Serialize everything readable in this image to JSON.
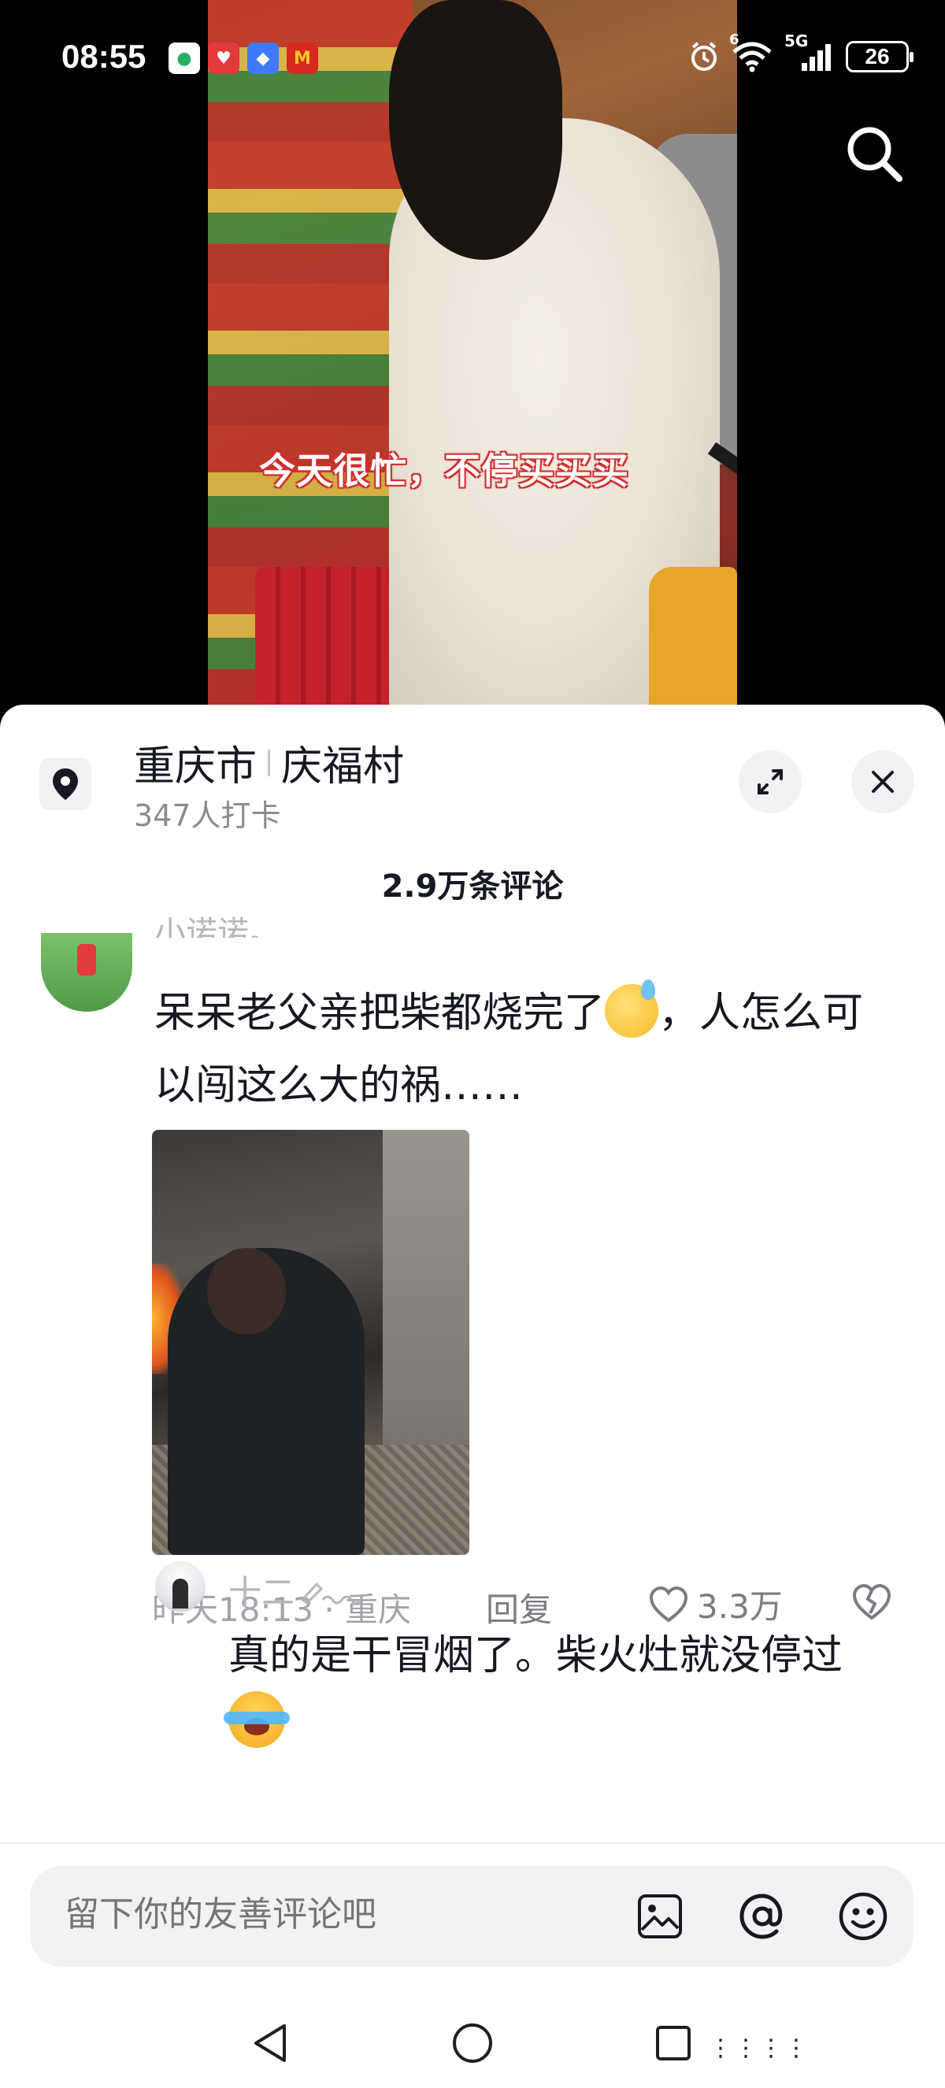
{
  "status_bar": {
    "time": "08:55",
    "network_type": "5G",
    "wifi_level": "6",
    "battery": "26"
  },
  "video": {
    "subtitle": "今天很忙，不停买买买",
    "search_icon": "search-icon"
  },
  "location": {
    "city": "重庆市",
    "place": "庆福村",
    "checkins": "347人打卡"
  },
  "comments_header": {
    "count_label": "2.9万条评论"
  },
  "comment": {
    "user_partial": "小诺诺。",
    "text": "呆呆老父亲把柴都烧完了",
    "text_tail": "，人怎么可以闯这么大的祸……",
    "time_location": "昨天18:13 · 重庆",
    "reply_label": "回复",
    "likes": "3.3万"
  },
  "reply": {
    "user": "十二",
    "text": "真的是干冒烟了。柴火灶就没停过"
  },
  "input": {
    "placeholder": "留下你的友善评论吧"
  },
  "nav": {
    "extra_glyph": "⋮⋮⋮⋮"
  },
  "colors": {
    "text_primary": "#161823",
    "text_secondary": "#8a8b91",
    "panel_bg": "#ffffff",
    "chip_bg": "#f2f2f4",
    "subtitle_stroke": "#d0302f"
  }
}
